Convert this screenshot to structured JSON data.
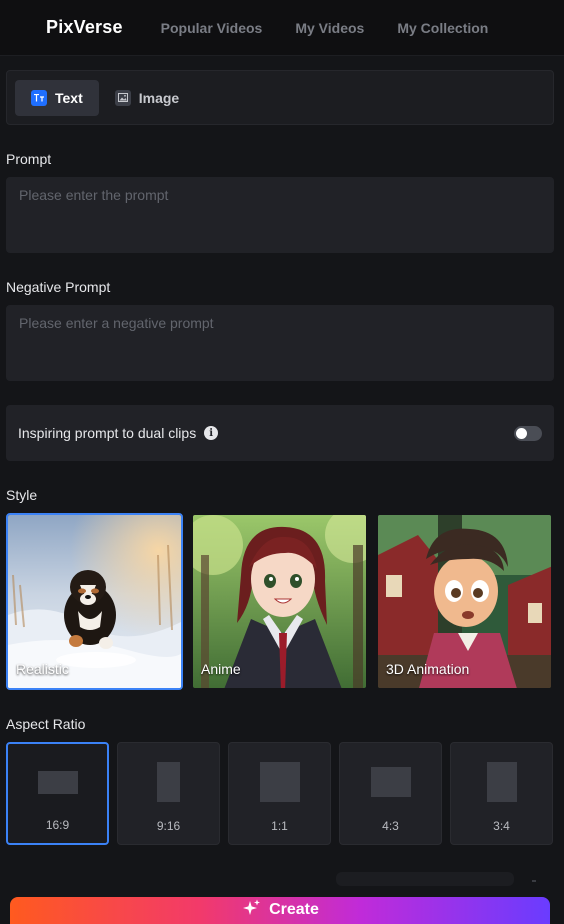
{
  "header": {
    "logo": "PixVerse",
    "nav": [
      "Popular Videos",
      "My Videos",
      "My Collection"
    ]
  },
  "mode_tabs": [
    {
      "label": "Text",
      "icon": "text-icon",
      "active": true
    },
    {
      "label": "Image",
      "icon": "image-icon",
      "active": false
    }
  ],
  "prompt": {
    "label": "Prompt",
    "placeholder": "Please enter the prompt",
    "value": ""
  },
  "negative_prompt": {
    "label": "Negative Prompt",
    "placeholder": "Please enter a negative prompt",
    "value": ""
  },
  "dual_clips": {
    "label": "Inspiring prompt to dual clips",
    "info_icon": "info-icon",
    "enabled": false
  },
  "style": {
    "label": "Style",
    "options": [
      {
        "label": "Realistic",
        "selected": true
      },
      {
        "label": "Anime",
        "selected": false
      },
      {
        "label": "3D Animation",
        "selected": false
      }
    ]
  },
  "aspect_ratio": {
    "label": "Aspect Ratio",
    "options": [
      {
        "label": "16:9",
        "selected": true
      },
      {
        "label": "9:16",
        "selected": false
      },
      {
        "label": "1:1",
        "selected": false
      },
      {
        "label": "4:3",
        "selected": false
      },
      {
        "label": "3:4",
        "selected": false
      }
    ]
  },
  "create_button": {
    "label": "Create",
    "icon": "sparkle-icon"
  },
  "colors": {
    "background": "#141518",
    "panel": "#212227",
    "accent_blue": "#3b82f6",
    "text_tab_icon": "#1f6fff",
    "create_gradient": [
      "#ff5a1f",
      "#f23a6a",
      "#c02bd9",
      "#6a3cff"
    ]
  }
}
